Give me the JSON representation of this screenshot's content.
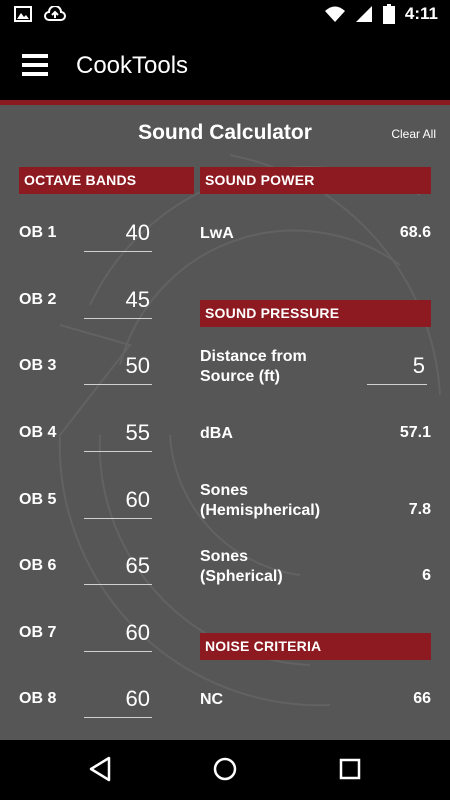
{
  "statusbar": {
    "time": "4:11",
    "left_icons": [
      "image-icon",
      "cloud-upload-icon"
    ],
    "right_icons": [
      "wifi-icon",
      "signal-icon",
      "battery-icon"
    ]
  },
  "appbar": {
    "title": "CookTools",
    "menu_icon": "hamburger-menu-icon"
  },
  "page": {
    "title": "Sound Calculator",
    "clear_all": "Clear All"
  },
  "octave_bands": {
    "header": "OCTAVE BANDS",
    "items": [
      {
        "label": "OB 1",
        "value": "40"
      },
      {
        "label": "OB 2",
        "value": "45"
      },
      {
        "label": "OB 3",
        "value": "50"
      },
      {
        "label": "OB 4",
        "value": "55"
      },
      {
        "label": "OB 5",
        "value": "60"
      },
      {
        "label": "OB 6",
        "value": "65"
      },
      {
        "label": "OB 7",
        "value": "60"
      },
      {
        "label": "OB 8",
        "value": "60"
      }
    ]
  },
  "sound_power": {
    "header": "SOUND POWER",
    "lwa_label": "LwA",
    "lwa_value": "68.6"
  },
  "sound_pressure": {
    "header": "SOUND PRESSURE",
    "distance_label_1": "Distance from",
    "distance_label_2": "Source (ft)",
    "distance_value": "5",
    "dba_label": "dBA",
    "dba_value": "57.1",
    "sones_hemi_label_1": "Sones",
    "sones_hemi_label_2": "(Hemispherical)",
    "sones_hemi_value": "7.8",
    "sones_sph_label_1": "Sones",
    "sones_sph_label_2": "(Spherical)",
    "sones_sph_value": "6"
  },
  "noise_criteria": {
    "header": "NOISE CRITERIA",
    "nc_label": "NC",
    "nc_value": "66"
  },
  "colors": {
    "accent": "#8d1a20",
    "background": "#565656",
    "bar": "#000000"
  },
  "navbar": {
    "icons": [
      "back-icon",
      "home-icon",
      "recents-icon"
    ]
  }
}
